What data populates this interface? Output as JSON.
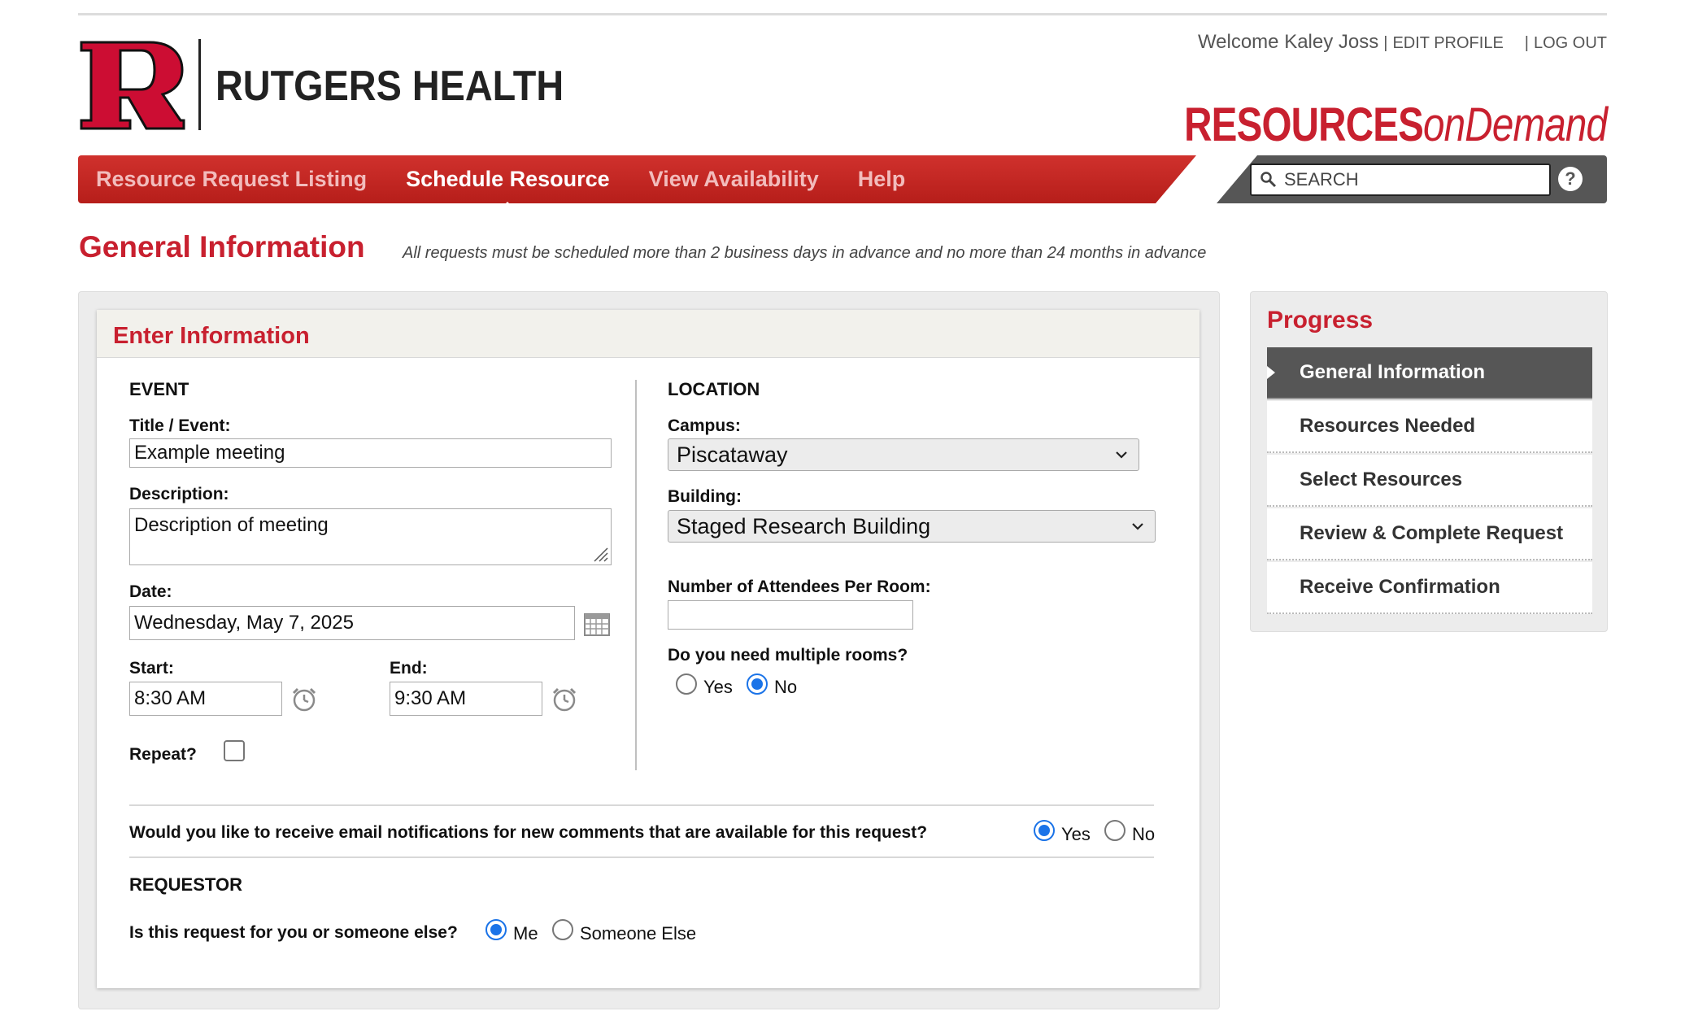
{
  "header": {
    "brand": "RUTGERS HEALTH",
    "welcome_text": "Welcome Kaley Joss",
    "edit_profile": "EDIT PROFILE",
    "log_out": "LOG OUT",
    "separator": "|",
    "product_name_bold": "RESOURCES",
    "product_name_italic": "onDemand"
  },
  "nav": {
    "items": [
      "Resource Request Listing",
      "Schedule Resource",
      "View Availability",
      "Help"
    ],
    "active": "Schedule Resource",
    "search_placeholder": "SEARCH",
    "help_icon": "?"
  },
  "page": {
    "title": "General Information",
    "subtitle": "All requests must be scheduled more than 2 business days in advance and no more than 24 months in advance"
  },
  "form": {
    "panel_title": "Enter Information",
    "event": {
      "section": "EVENT",
      "title_label": "Title / Event:",
      "title_value": "Example meeting",
      "description_label": "Description:",
      "description_value": "Description of meeting",
      "date_label": "Date:",
      "date_value": "Wednesday, May 7, 2025",
      "start_label": "Start:",
      "start_value": "8:30 AM",
      "end_label": "End:",
      "end_value": "9:30 AM",
      "repeat_label": "Repeat?"
    },
    "location": {
      "section": "LOCATION",
      "campus_label": "Campus:",
      "campus_value": "Piscataway",
      "building_label": "Building:",
      "building_value": "Staged Research Building",
      "attendees_label": "Number of Attendees Per Room:",
      "attendees_value": "",
      "multiple_rooms_label": "Do you need multiple rooms?",
      "yes": "Yes",
      "no": "No",
      "multiple_rooms_selected": "No"
    },
    "notifications": {
      "question": "Would you like to receive email notifications for new comments that are available for this request?",
      "yes": "Yes",
      "no": "No",
      "selected": "Yes"
    },
    "requestor": {
      "section": "REQUESTOR",
      "question": "Is this request for you or someone else?",
      "me": "Me",
      "someone_else": "Someone Else",
      "selected": "Me"
    }
  },
  "progress": {
    "title": "Progress",
    "steps": [
      "General Information",
      "Resources Needed",
      "Select Resources",
      "Review & Complete Request",
      "Receive Confirmation"
    ],
    "active": "General Information"
  },
  "colors": {
    "brand_red": "#c8202f",
    "nav_dark": "#565656",
    "radio_blue": "#1a73e8"
  },
  "icons": [
    "rutgers-r-logo",
    "search-icon",
    "help-icon",
    "calendar-icon",
    "clock-icon",
    "chevron-down-icon",
    "resize-grip-icon"
  ]
}
